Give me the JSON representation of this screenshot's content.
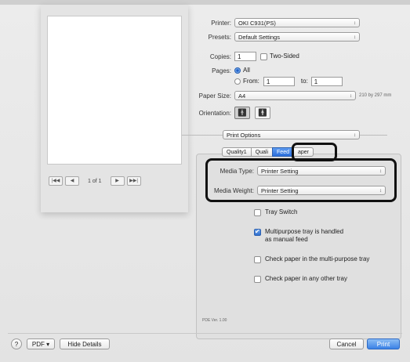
{
  "printer": {
    "label": "Printer:",
    "value": "OKI C931(PS)"
  },
  "presets": {
    "label": "Presets:",
    "value": "Default Settings"
  },
  "copies": {
    "label": "Copies:",
    "value": "1",
    "two_sided_label": "Two-Sided",
    "two_sided_checked": false
  },
  "pages": {
    "label": "Pages:",
    "all_label": "All",
    "from_label": "From:",
    "from_value": "1",
    "to_label": "to:",
    "to_value": "1",
    "selected": "All"
  },
  "paper_size": {
    "label": "Paper Size:",
    "value": "A4",
    "dimensions": "210 by 297 mm"
  },
  "orientation": {
    "label": "Orientation:",
    "selected": "portrait"
  },
  "section_popup": {
    "value": "Print Options"
  },
  "tabs": [
    {
      "label": "Quality1",
      "selected": false
    },
    {
      "label": "Quali",
      "selected": false
    },
    {
      "label": "Feed",
      "selected": true
    },
    {
      "label": "aper",
      "selected": false
    }
  ],
  "media_type": {
    "label": "Media Type:",
    "value": "Printer Setting"
  },
  "media_weight": {
    "label": "Media Weight:",
    "value": "Printer Setting"
  },
  "options": [
    {
      "label": "Tray Switch",
      "checked": false
    },
    {
      "label_line1": "Multipurpose tray is handled",
      "label_line2": "as manual feed",
      "checked": true
    },
    {
      "label": "Check paper in the multi-purpose tray",
      "checked": false
    },
    {
      "label": "Check paper in any other tray",
      "checked": false
    }
  ],
  "version_text": "PDE Ver. 1.00",
  "pager": {
    "first": "|◀◀",
    "prev": "◀",
    "text": "1 of 1",
    "next": "▶",
    "last": "▶▶|"
  },
  "bottom": {
    "help": "?",
    "pdf_label": "PDF ▾",
    "hide_details_label": "Hide Details",
    "cancel_label": "Cancel",
    "print_label": "Print"
  },
  "colors": {
    "accent": "#2c6fdc",
    "highlight_border": "#111111"
  }
}
